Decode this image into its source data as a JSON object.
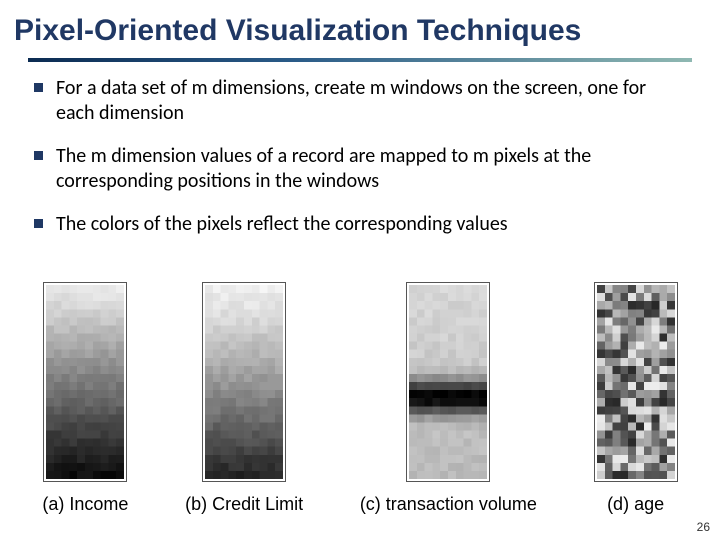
{
  "title": "Pixel-Oriented Visualization Techniques",
  "bullets": [
    "For a data set of m dimensions, create m windows on the screen, one for each dimension",
    "The m dimension values of a record are mapped to m pixels at the corresponding positions in the windows",
    "The colors of the pixels reflect the corresponding values"
  ],
  "figures": [
    {
      "caption": "(a) Income",
      "pattern": "gradient_light_to_dark"
    },
    {
      "caption": "(b) Credit Limit",
      "pattern": "gradient_top_light_midfade"
    },
    {
      "caption": "(c) transaction volume",
      "pattern": "light_with_dark_band"
    },
    {
      "caption": "(d) age",
      "pattern": "random_mosaic"
    }
  ],
  "page_number": "26"
}
